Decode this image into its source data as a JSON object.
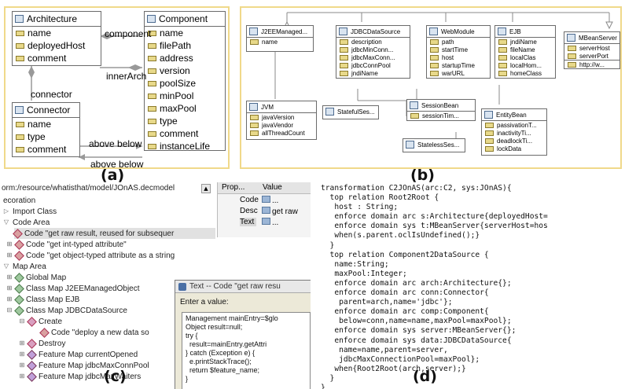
{
  "panel_a": {
    "tag": "(a)",
    "classes": [
      {
        "title": "Architecture",
        "attrs": [
          "name",
          "deployedHost",
          "comment"
        ]
      },
      {
        "title": "Component",
        "attrs": [
          "name",
          "filePath",
          "address",
          "version",
          "poolSize",
          "minPool",
          "maxPool",
          "type",
          "comment",
          "instanceLife"
        ]
      },
      {
        "title": "Connector",
        "attrs": [
          "name",
          "type",
          "comment"
        ]
      }
    ],
    "labels": {
      "component": "component",
      "innerArch": "innerArch",
      "connector": "connector",
      "above_below_1": "above below",
      "above_below_2": "above below"
    }
  },
  "panel_b": {
    "tag": "(b)",
    "classes": [
      {
        "title": "J2EEManaged...",
        "attrs": [
          "name"
        ]
      },
      {
        "title": "JDBCDataSource",
        "attrs": [
          "description",
          "jdbcMinConn...",
          "jdbcMaxConn...",
          "jdbcConnPool",
          "jndiName"
        ]
      },
      {
        "title": "WebModule",
        "attrs": [
          "path",
          "startTime",
          "host",
          "startupTime",
          "warURL"
        ]
      },
      {
        "title": "EJB",
        "attrs": [
          "jndiName",
          "fileName",
          "localClas",
          "localHom...",
          "homeClass"
        ]
      },
      {
        "title": "MBeanServer",
        "attrs": [
          "serverHost",
          "serverPort",
          "http://w..."
        ]
      },
      {
        "title": "JVM",
        "attrs": [
          "javaVersion",
          "javaVendor",
          "allThreadCount"
        ]
      },
      {
        "title": "StatefulSes...",
        "attrs": []
      },
      {
        "title": "SessionBean",
        "attrs": [
          "sessionTim..."
        ]
      },
      {
        "title": "StatelessSes...",
        "attrs": []
      },
      {
        "title": "EntityBean",
        "attrs": [
          "passivationT...",
          "inactivityTi...",
          "deadlockTi...",
          "lockData"
        ]
      }
    ]
  },
  "panel_c": {
    "tag": "(c)",
    "path": "orm:/resource/whatisthat/model/JOnAS.decmodel",
    "tree": [
      "ecoration",
      "Import Class",
      "Code Area",
      "Code \"get raw result, reused for subsequer",
      "Code \"get int-typed attribute\"",
      "Code \"get object-typed attribute as a string",
      "Map Area",
      "Global Map",
      "Class Map J2EEManagedObject",
      "Class Map EJB",
      "Class Map JDBCDataSource",
      "Create",
      "Code \"deploy a new data so",
      "Destroy",
      "Feature Map currentOpened",
      "Feature Map jdbcMaxConnPool",
      "Feature Map jdbcMaxWaiters"
    ],
    "props": {
      "headers": [
        "Prop...",
        "Value"
      ],
      "rows": [
        {
          "prop": "Code",
          "value": "..."
        },
        {
          "prop": "Desc",
          "value": "get raw"
        },
        {
          "prop": "Text",
          "value": "..."
        }
      ]
    },
    "dialog": {
      "title": "Text -- Code \"get raw resu",
      "prompt": "Enter a value:",
      "code": "Management mainEntry=$glo\nObject result=null;\ntry {\n  result=mainEntry.getAttri\n} catch (Exception e) {\n  e.printStackTrace();\n  return $feature_name;\n}"
    }
  },
  "panel_d": {
    "tag": "(d)",
    "code": "transformation C2JOnAS(arc:C2, sys:JOnAS){\n  top relation Root2Root {\n   host : String;\n   enforce domain arc s:Architecture{deployedHost=\n   enforce domain sys t:MBeanServer{serverHost=hos\n   when(s.parent.oclIsUndefined();}\n  }\n  top relation Component2DataSource {\n   name:String;\n   maxPool:Integer;\n   enforce domain arc arch:Architecture{};\n   enforce domain arc conn:Connector{\n    parent=arch,name='jdbc'};\n   enforce domain arc comp:Component{\n    below=conn,name=name,maxPool=maxPool};\n   enforce domain sys server:MBeanServer{};\n   enforce domain sys data:JDBCDataSource{\n    name=name,parent=server,\n    jdbcMaxConnectionPool=maxPool};\n   when{Root2Root(arch,server);}\n  }\n}"
  }
}
